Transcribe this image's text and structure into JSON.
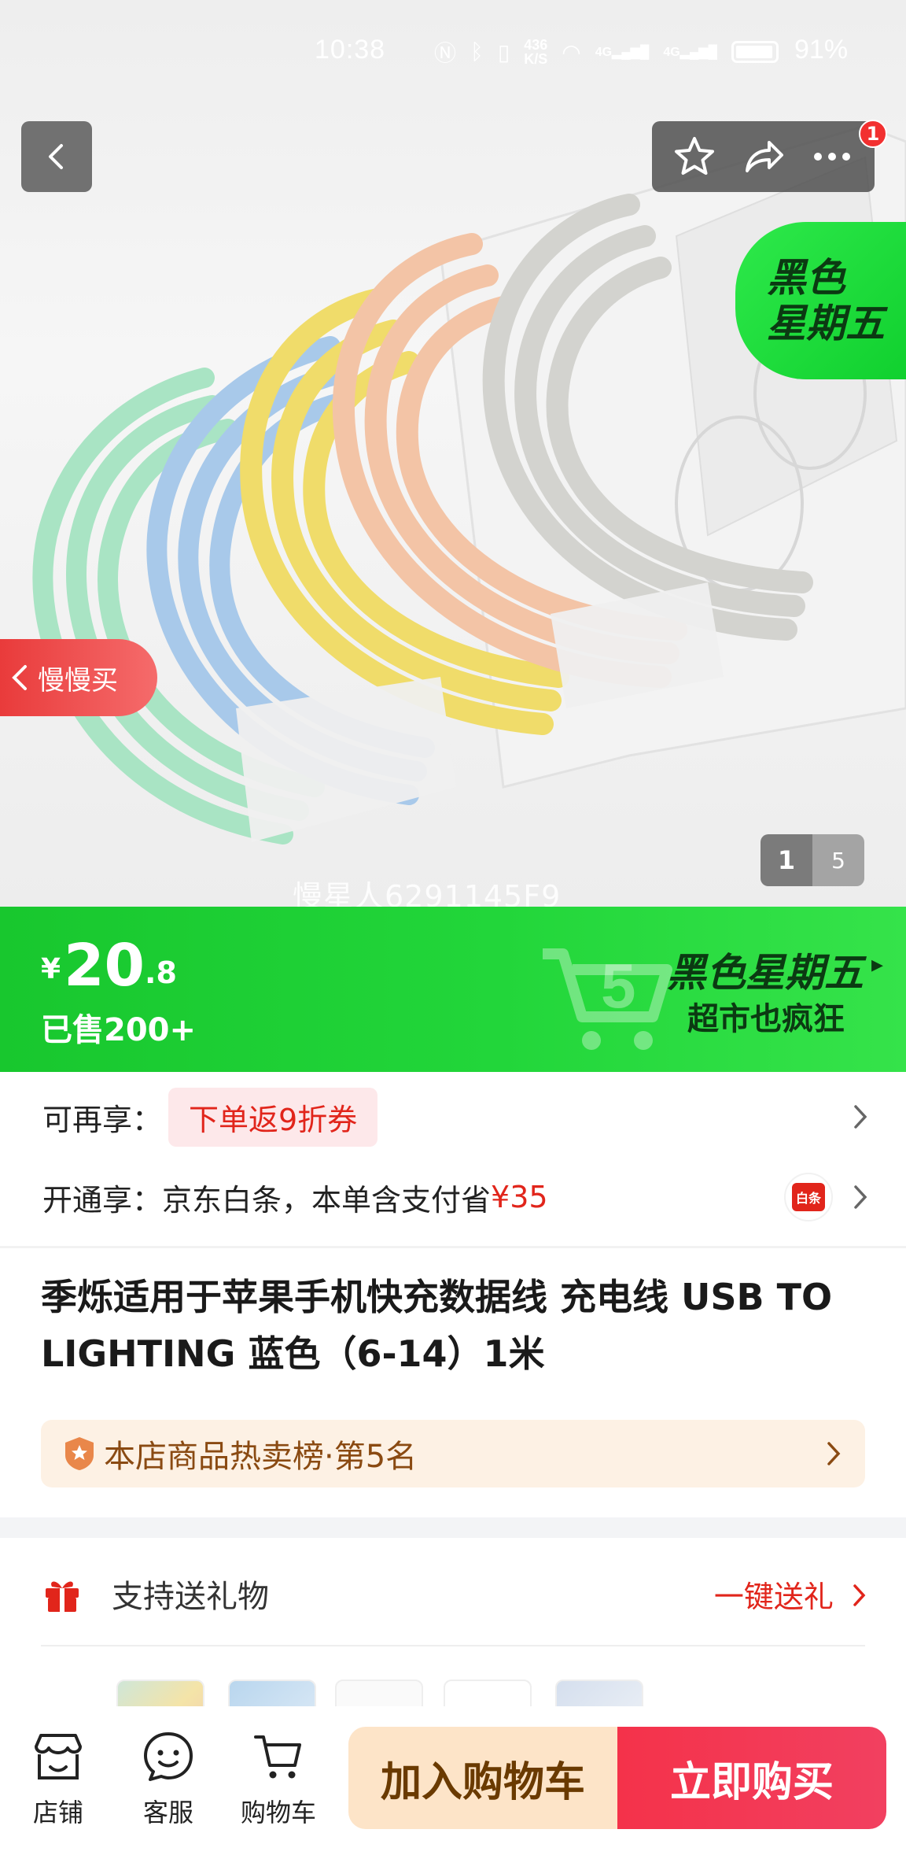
{
  "status_bar": {
    "time": "10:38",
    "net_speed_top": "436",
    "net_speed_bottom": "K/S",
    "signal_1": "4G",
    "signal_2": "4G",
    "battery": "91%"
  },
  "hero": {
    "sticker_line1": "黑色",
    "sticker_line2": "星期五",
    "slow_buy_label": "慢慢买",
    "pager_current": "1",
    "pager_total": "5",
    "watermark": "慢星人6291145F9",
    "cart_badge": "1"
  },
  "price_bar": {
    "currency": "¥",
    "price_int": "20",
    "price_dec": ".8",
    "sold": "已售200+",
    "event_title": "黑色星期五",
    "event_sub": "超市也疯狂",
    "event_arrow": "▸"
  },
  "benefits": {
    "row1_label": "可再享：",
    "row1_coupon": "下单返9折券",
    "row2_label": "开通享：",
    "row2_text": "京东白条，本单含支付省",
    "row2_amount": "¥35",
    "baitiao_icon_text": "白条"
  },
  "product": {
    "title": "季烁适用于苹果手机快充数据线 充电线 USB TO LIGHTING 蓝色（6-14）1米",
    "rank_text": "本店商品热卖榜·第5名"
  },
  "gift": {
    "label": "支持送礼物",
    "link": "一键送礼"
  },
  "bottom_bar": {
    "tabs": [
      {
        "label": "店铺"
      },
      {
        "label": "客服"
      },
      {
        "label": "购物车"
      }
    ],
    "add_to_cart": "加入购物车",
    "buy_now": "立即购买"
  },
  "colors": {
    "jd_red": "#e1251b",
    "promo_green": "#22d63a",
    "cart_btn_bg": "#fde4c8",
    "buy_btn_bg": "#f4324a"
  },
  "icons": [
    "back-icon",
    "star-icon",
    "share-icon",
    "more-icon",
    "gift-icon",
    "shop-icon",
    "service-icon",
    "cart-icon",
    "medal-icon",
    "chevron-right-icon"
  ]
}
